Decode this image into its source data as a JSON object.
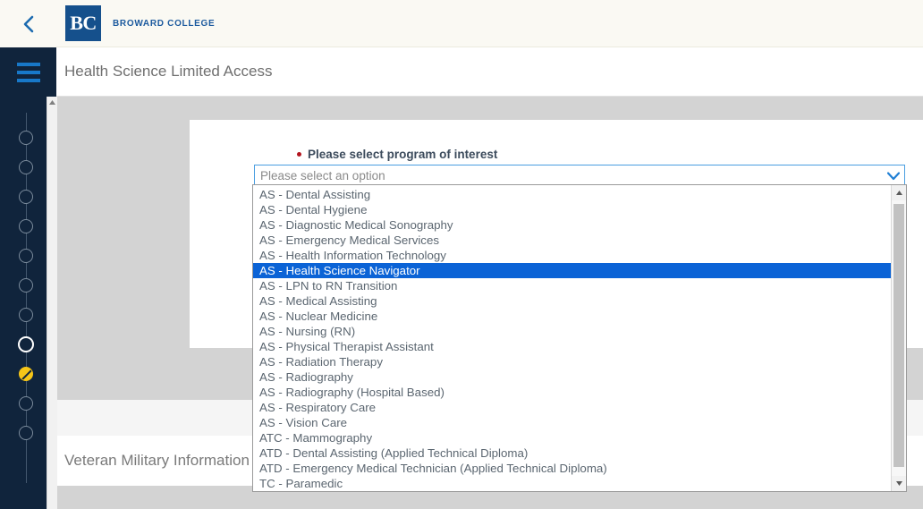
{
  "topbar": {
    "back_icon": "chevron-left-icon",
    "logo_text": "BC",
    "brand_name": "BROWARD COLLEGE"
  },
  "header": {
    "title": "Health Science Limited Access",
    "menu_icon": "hamburger-menu-icon"
  },
  "sidebar": {
    "steps": [
      {
        "state": "incomplete"
      },
      {
        "state": "incomplete"
      },
      {
        "state": "incomplete"
      },
      {
        "state": "incomplete"
      },
      {
        "state": "incomplete"
      },
      {
        "state": "incomplete"
      },
      {
        "state": "incomplete"
      },
      {
        "state": "active"
      },
      {
        "state": "warning"
      },
      {
        "state": "incomplete"
      },
      {
        "state": "incomplete"
      }
    ]
  },
  "form": {
    "program_field": {
      "label": "Please select program of interest",
      "required": true,
      "placeholder": "Please select an option",
      "value": "",
      "arrow_icon": "chevron-down-icon",
      "expanded": true,
      "selected_option": "AS - Health Science Navigator",
      "options": [
        "AS - Dental Assisting",
        "AS - Dental Hygiene",
        "AS - Diagnostic Medical Sonography",
        "AS - Emergency Medical Services",
        "AS - Health Information Technology",
        "AS - Health Science Navigator",
        "AS - LPN to RN Transition",
        "AS - Medical Assisting",
        "AS - Nuclear Medicine",
        "AS - Nursing (RN)",
        "AS - Physical Therapist Assistant",
        "AS - Radiation Therapy",
        "AS - Radiography",
        "AS - Radiography (Hospital Based)",
        "AS - Respiratory Care",
        "AS - Vision Care",
        "ATC - Mammography",
        "ATD - Dental Assisting (Applied Technical Diploma)",
        "ATD - Emergency Medical Technician (Applied Technical Diploma)",
        "TC - Paramedic"
      ]
    }
  },
  "sections": {
    "veteran_heading": "Veteran Military Information"
  },
  "colors": {
    "brand_blue": "#15508c",
    "rail_navy": "#10243c",
    "accent_blue": "#1878c8",
    "highlight_blue": "#0b63d6",
    "required_red": "#b3141e",
    "warning_yellow": "#f5c518",
    "topbar_cream": "#faf9f3"
  }
}
